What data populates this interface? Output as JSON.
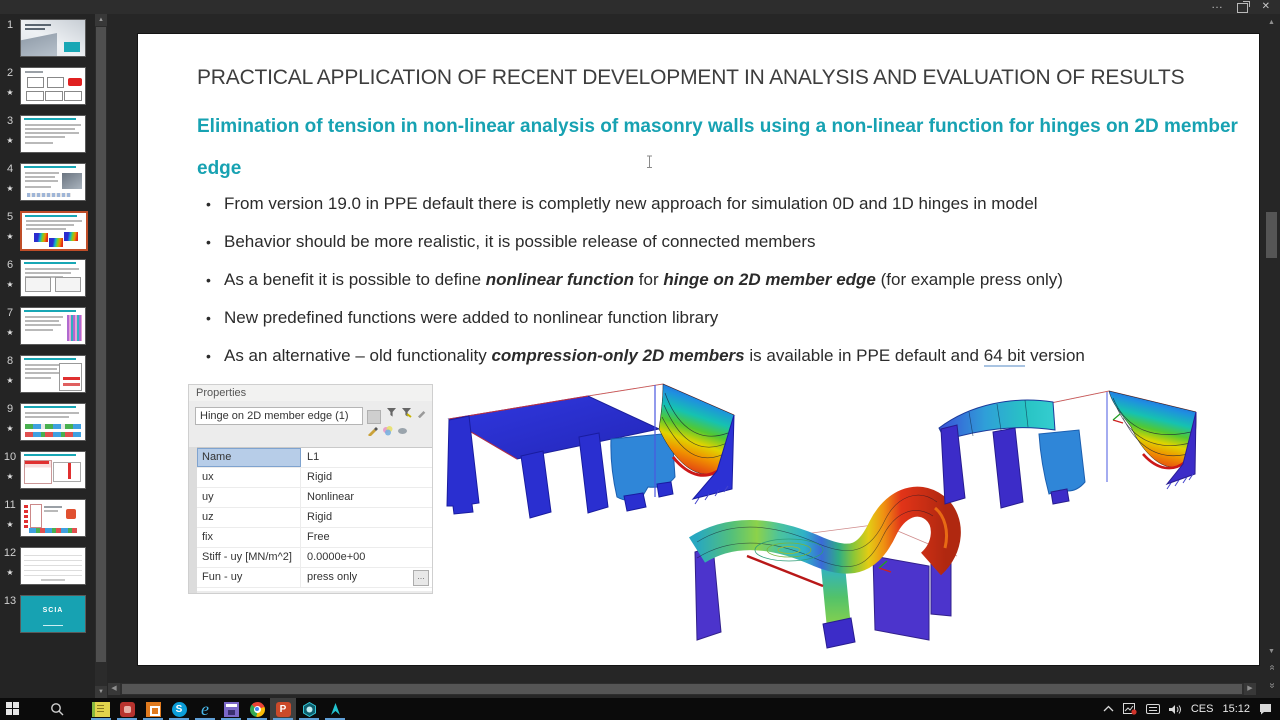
{
  "colors": {
    "accent_teal": "#17a2b2",
    "selection_orange": "#bf4d28",
    "taskbar_underline": "#5f9fd6",
    "fem_palette": [
      "#2b2bd0",
      "#1f7fe8",
      "#14b4d8",
      "#16c28a",
      "#7fd01f",
      "#e8d400",
      "#f09000",
      "#e02a18"
    ]
  },
  "window": {
    "ellipsis_label": "…",
    "close_glyph": "✕"
  },
  "panel": {
    "star_char": "★",
    "slides": [
      {
        "num": "1",
        "starred": false,
        "variant": "cover"
      },
      {
        "num": "2",
        "starred": true,
        "variant": "boxes"
      },
      {
        "num": "3",
        "starred": true,
        "variant": "text"
      },
      {
        "num": "4",
        "starred": true,
        "variant": "text-img"
      },
      {
        "num": "5",
        "starred": true,
        "variant": "models",
        "selected": true
      },
      {
        "num": "6",
        "starred": true,
        "variant": "two-shots"
      },
      {
        "num": "7",
        "starred": true,
        "variant": "text-stripes"
      },
      {
        "num": "8",
        "starred": true,
        "variant": "text-table"
      },
      {
        "num": "9",
        "starred": true,
        "variant": "color-strips"
      },
      {
        "num": "10",
        "starred": true,
        "variant": "red-tables"
      },
      {
        "num": "11",
        "starred": true,
        "variant": "diagram"
      },
      {
        "num": "12",
        "starred": true,
        "variant": "grid"
      },
      {
        "num": "13",
        "starred": false,
        "variant": "scia",
        "label": "SCIA"
      }
    ]
  },
  "slide": {
    "title": "PRACTICAL APPLICATION OF RECENT DEVELOPMENT IN ANALYSIS AND EVALUATION OF RESULTS",
    "subtitle": "Elimination of tension in non-linear analysis of masonry walls using a non-linear function for hinges on 2D member edge",
    "bullet_char": "•",
    "bullets": [
      [
        {
          "t": "From version 19.0 in PPE default there is completly new approach for simulation 0D and 1D hinges in model"
        }
      ],
      [
        {
          "t": "Behavior should be more realistic, it is possible release of connected members"
        }
      ],
      [
        {
          "t": "As a benefit it is possible to define "
        },
        {
          "t": "nonlinear function",
          "b": true,
          "i": true
        },
        {
          "t": " for "
        },
        {
          "t": "hinge on 2D member edge",
          "b": true,
          "i": true
        },
        {
          "t": " (for example press only)"
        }
      ],
      [
        {
          "t": "New predefined functions were added to nonlinear function library"
        }
      ],
      [
        {
          "t": "As an alternative – old functionality "
        },
        {
          "t": "compression-only 2D members",
          "b": true,
          "i": true
        },
        {
          "t": " is available in PPE default and "
        },
        {
          "t": "64 bit",
          "u": true
        },
        {
          "t": " version"
        }
      ]
    ],
    "properties": {
      "title": "Properties",
      "selector": "Hinge on 2D member edge (1)",
      "more_glyph": "…",
      "rows": [
        {
          "name": "Name",
          "value": "L1",
          "selected": true
        },
        {
          "name": "ux",
          "value": "Rigid"
        },
        {
          "name": "uy",
          "value": "Nonlinear"
        },
        {
          "name": "uz",
          "value": "Rigid"
        },
        {
          "name": "fix",
          "value": "Free"
        },
        {
          "name": "Stiff - uy [MN/m^2]",
          "value": "0.0000e+00"
        },
        {
          "name": "Fun - uy",
          "value": "press only",
          "more": true
        }
      ]
    }
  },
  "taskbar": {
    "glyphs": {
      "skype": "S",
      "ie": "e",
      "powerpoint": "P"
    },
    "tray": {
      "language": "CES",
      "time": "15:12"
    }
  }
}
